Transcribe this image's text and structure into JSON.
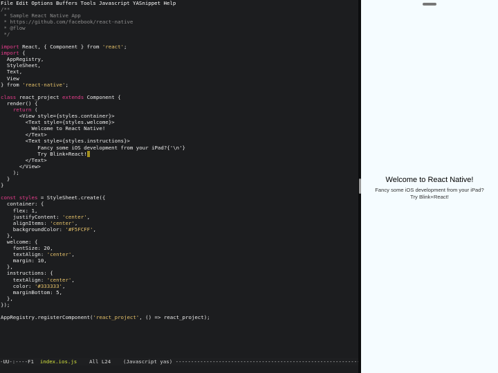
{
  "menubar": {
    "items": [
      "File",
      "Edit",
      "Options",
      "Buffers",
      "Tools",
      "Javascript",
      "YASnippet",
      "Help"
    ]
  },
  "code_lines": [
    [
      [
        "c",
        "/**"
      ]
    ],
    [
      [
        "c",
        " * Sample React Native App"
      ]
    ],
    [
      [
        "c",
        " * https://github.com/facebook/react-native"
      ]
    ],
    [
      [
        "c",
        " * @flow"
      ]
    ],
    [
      [
        "c",
        " */"
      ]
    ],
    [
      [
        "p",
        ""
      ]
    ],
    [
      [
        "k",
        "import"
      ],
      [
        "p",
        " React, { Component } from "
      ],
      [
        "s",
        "'react'"
      ],
      [
        "p",
        ";"
      ]
    ],
    [
      [
        "k",
        "import"
      ],
      [
        "p",
        " {"
      ]
    ],
    [
      [
        "p",
        "  AppRegistry,"
      ]
    ],
    [
      [
        "p",
        "  StyleSheet,"
      ]
    ],
    [
      [
        "p",
        "  Text,"
      ]
    ],
    [
      [
        "p",
        "  View"
      ]
    ],
    [
      [
        "p",
        "} from "
      ],
      [
        "s",
        "'react-native'"
      ],
      [
        "p",
        ";"
      ]
    ],
    [
      [
        "p",
        ""
      ]
    ],
    [
      [
        "k",
        "class"
      ],
      [
        "p",
        " react_project "
      ],
      [
        "k",
        "extends"
      ],
      [
        "p",
        " Component {"
      ]
    ],
    [
      [
        "p",
        "  render() {"
      ]
    ],
    [
      [
        "p",
        "    "
      ],
      [
        "k",
        "return"
      ],
      [
        "p",
        " ("
      ]
    ],
    [
      [
        "p",
        "      <View style={styles.container}>"
      ]
    ],
    [
      [
        "p",
        "        <Text style={styles.welcome}>"
      ]
    ],
    [
      [
        "p",
        "          Welcome to React Native!"
      ]
    ],
    [
      [
        "p",
        "        </Text>"
      ]
    ],
    [
      [
        "p",
        "        <Text style={styles.instructions}>"
      ]
    ],
    [
      [
        "p",
        "            Fancy some iOS development from your iPad?{'\\n'}"
      ]
    ],
    [
      [
        "p",
        "            Try Blink+React!"
      ],
      [
        "cur",
        " "
      ]
    ],
    [
      [
        "p",
        "        </Text>"
      ]
    ],
    [
      [
        "p",
        "      </View>"
      ]
    ],
    [
      [
        "p",
        "    );"
      ]
    ],
    [
      [
        "p",
        "  }"
      ]
    ],
    [
      [
        "p",
        "}"
      ]
    ],
    [
      [
        "p",
        ""
      ]
    ],
    [
      [
        "k",
        "const"
      ],
      [
        "p",
        " "
      ],
      [
        "k",
        "styles"
      ],
      [
        "p",
        " = StyleSheet.create({"
      ]
    ],
    [
      [
        "p",
        "  container: {"
      ]
    ],
    [
      [
        "p",
        "    flex: 1,"
      ]
    ],
    [
      [
        "p",
        "    justifyContent: "
      ],
      [
        "s",
        "'center'"
      ],
      [
        "p",
        ","
      ]
    ],
    [
      [
        "p",
        "    alignItems: "
      ],
      [
        "s",
        "'center'"
      ],
      [
        "p",
        ","
      ]
    ],
    [
      [
        "p",
        "    backgroundColor: "
      ],
      [
        "s",
        "'#F5FCFF'"
      ],
      [
        "p",
        ","
      ]
    ],
    [
      [
        "p",
        "  },"
      ]
    ],
    [
      [
        "p",
        "  welcome: {"
      ]
    ],
    [
      [
        "p",
        "    fontSize: 20,"
      ]
    ],
    [
      [
        "p",
        "    textAlign: "
      ],
      [
        "s",
        "'center'"
      ],
      [
        "p",
        ","
      ]
    ],
    [
      [
        "p",
        "    margin: 10,"
      ]
    ],
    [
      [
        "p",
        "  },"
      ]
    ],
    [
      [
        "p",
        "  instructions: {"
      ]
    ],
    [
      [
        "p",
        "    textAlign: "
      ],
      [
        "s",
        "'center'"
      ],
      [
        "p",
        ","
      ]
    ],
    [
      [
        "p",
        "    color: "
      ],
      [
        "s",
        "'#333333'"
      ],
      [
        "p",
        ","
      ]
    ],
    [
      [
        "p",
        "    marginBottom: 5,"
      ]
    ],
    [
      [
        "p",
        "  },"
      ]
    ],
    [
      [
        "p",
        "});"
      ]
    ],
    [
      [
        "p",
        ""
      ]
    ],
    [
      [
        "p",
        "AppRegistry.registerComponent("
      ],
      [
        "s",
        "'react_project'"
      ],
      [
        "p",
        ", () => react_project);"
      ]
    ]
  ],
  "modeline": {
    "status": "-UU-:----F1  ",
    "buffer": "index.ios.js",
    "position": "    All L24    ",
    "mode": "(Javascript yas)",
    "fill": " -------------------------------------------------------------------------------------------------"
  },
  "simulator": {
    "welcome": "Welcome to React Native!",
    "instructions_line1": "Fancy some iOS development from your iPad?",
    "instructions_line2": "Try Blink+React!"
  },
  "colors": {
    "editor_bg": "#1c1d1f",
    "simulator_bg": "#F5FCFF",
    "keyword": "#e83d8d",
    "string": "#e6c26a",
    "comment": "#8e8e8e",
    "buffer_name": "#d4e23c"
  }
}
